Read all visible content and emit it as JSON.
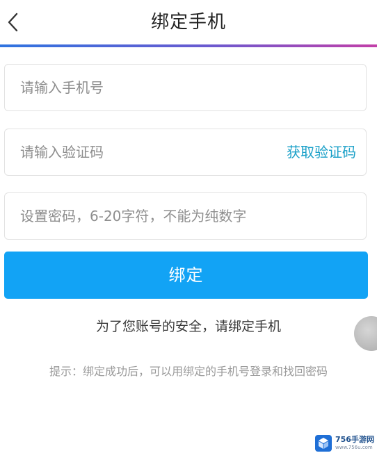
{
  "header": {
    "title": "绑定手机",
    "back_icon": "chevron-left-icon"
  },
  "form": {
    "phone": {
      "placeholder": "请输入手机号",
      "value": ""
    },
    "code": {
      "placeholder": "请输入验证码",
      "value": "",
      "get_code_label": "获取验证码"
    },
    "password": {
      "placeholder": "设置密码，6-20字符，不能为纯数字",
      "value": ""
    },
    "submit_label": "绑定"
  },
  "notice": "为了您账号的安全，请绑定手机",
  "hint": "提示：绑定成功后，可以用绑定的手机号登录和找回密码",
  "watermark": {
    "name": "756手游网",
    "url": "www.756u.com"
  },
  "colors": {
    "accent": "#12a3f5",
    "link": "#1aa0c8",
    "header_gradient_start": "#2f74e0",
    "header_gradient_end": "#c23fa8"
  }
}
